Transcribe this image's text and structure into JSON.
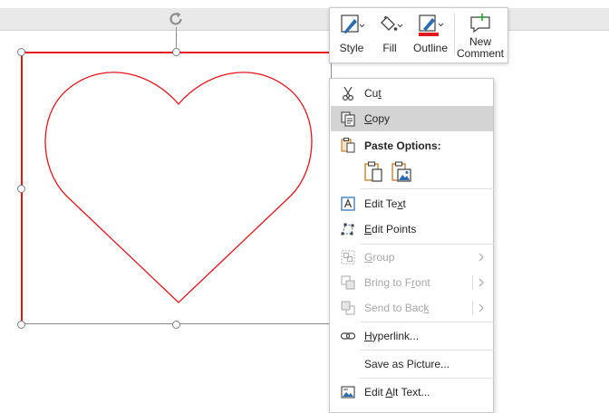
{
  "colors": {
    "shape_outline": "#e2161f",
    "accent_blue": "#2b6cb3",
    "outline_swatch": "#e2161f",
    "hover": "#d4d4d4"
  },
  "minibar": {
    "style_label": "Style",
    "fill_label": "Fill",
    "outline_label": "Outline",
    "new_comment_label_line1": "New",
    "new_comment_label_line2": "Comment"
  },
  "context_menu": {
    "cut": {
      "pre": "Cu",
      "key": "t",
      "post": ""
    },
    "copy": {
      "pre": "",
      "key": "C",
      "post": "opy"
    },
    "paste_options": "Paste Options:",
    "edit_text": {
      "pre": "Edit Te",
      "key": "x",
      "post": "t"
    },
    "edit_points": {
      "pre": "",
      "key": "E",
      "post": "dit Points"
    },
    "group": {
      "pre": "",
      "key": "G",
      "post": "roup"
    },
    "bring_to_front": {
      "pre": "Bring to F",
      "key": "r",
      "post": "ont"
    },
    "send_to_back": {
      "pre": "Send to Bac",
      "key": "k",
      "post": ""
    },
    "hyperlink": {
      "pre": "",
      "key": "H",
      "post": "yperlink..."
    },
    "save_as_picture": {
      "pre": "Save as Picture...",
      "key": "",
      "post": ""
    },
    "edit_alt_text": {
      "pre": "Edit ",
      "key": "A",
      "post": "lt Text..."
    }
  }
}
